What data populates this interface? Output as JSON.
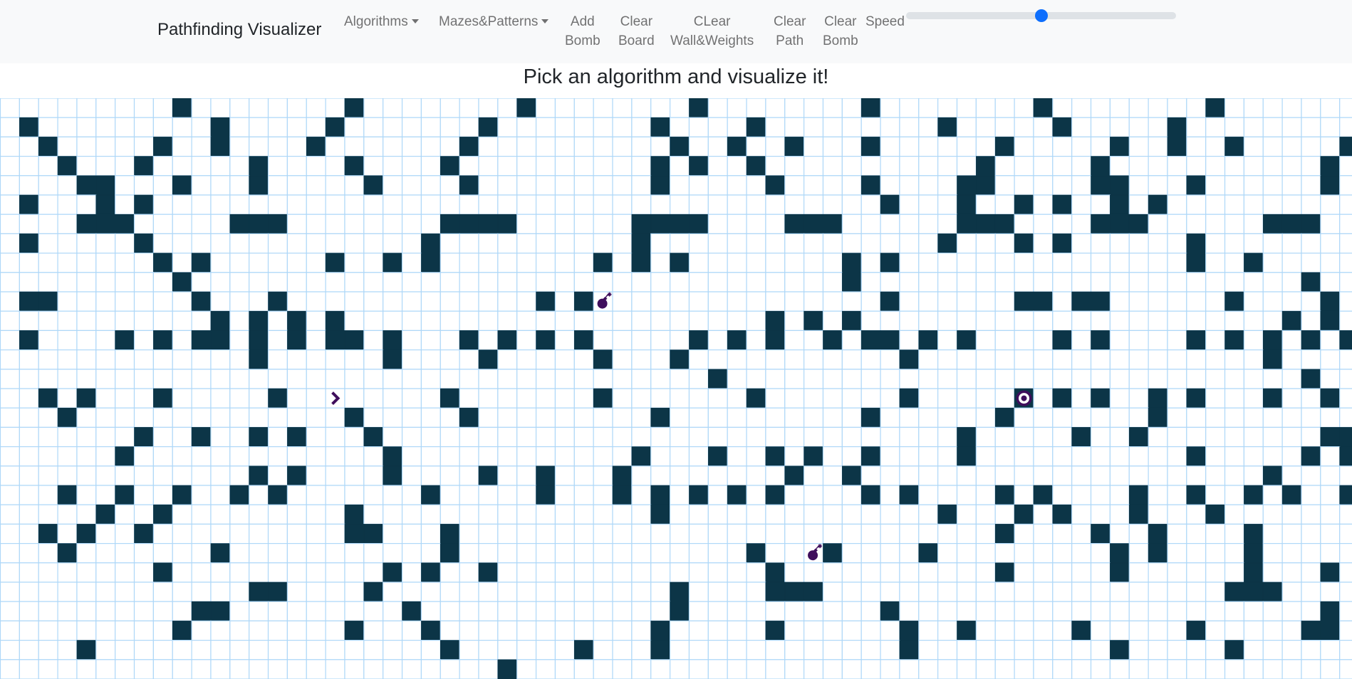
{
  "navbar": {
    "brand": "Pathfinding Visualizer",
    "items": [
      {
        "id": "algorithms",
        "lines": [
          "Algorithms"
        ],
        "dropdown": true
      },
      {
        "id": "mazes",
        "lines": [
          "Mazes&Patterns"
        ],
        "dropdown": true
      },
      {
        "id": "add-bomb",
        "lines": [
          "Add",
          "Bomb"
        ]
      },
      {
        "id": "clear-board",
        "lines": [
          "Clear",
          "Board"
        ]
      },
      {
        "id": "clear-walls-weights",
        "lines": [
          "CLear",
          "Wall&Weights"
        ]
      },
      {
        "id": "clear-path",
        "lines": [
          "Clear",
          "Path"
        ]
      },
      {
        "id": "clear-bomb",
        "lines": [
          "Clear",
          "Bomb"
        ]
      }
    ],
    "speed_label": "Speed",
    "speed_value": 0.5
  },
  "heading": "Pick an algorithm and visualize it!",
  "grid": {
    "rows": 30,
    "cols": 71,
    "start": {
      "row": 15,
      "col": 17,
      "icon": "chevron-right-icon"
    },
    "target": {
      "row": 15,
      "col": 53,
      "icon": "target-icon"
    },
    "bombs": [
      {
        "row": 10,
        "col": 31,
        "icon": "bomb-icon"
      },
      {
        "row": 23,
        "col": 42,
        "icon": "bomb-icon"
      }
    ],
    "walls": [
      "_________#________#________#________#________#________#________#_______",
      "_#_________#_____#_______#________#____#_________#_____#_____#_________",
      "__#_____#__#____#_______#__________#__#__#___#______#_____#__#__#_____#",
      "___#___#_____#____#____#__________#_#__#___________#_____#___________#_",
      "____##___#___#_____#____#_________#_____#____#____##_____##___#______#_",
      "_#___#_#______________________________________#___#__#_#__#_#__________",
      "____###_____###________####______####____###______###____###______###__",
      "_#_____#______________#__________#_______________#___#_#______#________",
      "________#_#______#__#_#________#_#_#________#_#_______________#__#_____",
      "_________#__________________________________#_______________________#__",
      "_##_______#___#_____________#_#_______________#______##_##______#____#_",
      "___________#_#_#_#______________________#_#_#______________________#_#_",
      "_#____#_#_##_#_#_##_#___#_#_#_#_____#_#_#__#_##_#_#____#_#____#_#_#_#_#",
      "_____________#______#____#_____#___#___________#__________________#____",
      "_____________________________________#______________________________#__",
      "__#_#___#_____#________#_______#_______#_______#_____#_#_#__#_#___#__#_",
      "___#______________#_____#_________#__________#______#_______#__________",
      "_______#__#__#_#___#______________________________#_____#__#_________##",
      "______#_____________#____________#___#__#_#__#____#___________#_____#_#",
      "_____________#_#____#____#__#___#________#__#_____________________#____",
      "___#__#__#__#_#_______#_____#___#_#_#_#_#____#_#____#_#____#__#__#_#__#",
      "_____#__#_________#_______________#______________#___#_#___#___#_______",
      "__#_#__#__________##___#____________________________#____#__#____#_____",
      "___#_______#___________#_______________#___#____#_________#_#____#_____",
      "________#___________#_#__#______________#___________#_____#______#___#_",
      "_____________##____#_______________#____###_____________________###____",
      "__________##_________#_____________#__________#______________________#_",
      "_________#________#___#___________#_____#______#__#_____#_____#_____##",
      "____#__________________#______#___#____________#__________#_____#______",
      "__________________________#____________________________________________"
    ]
  }
}
